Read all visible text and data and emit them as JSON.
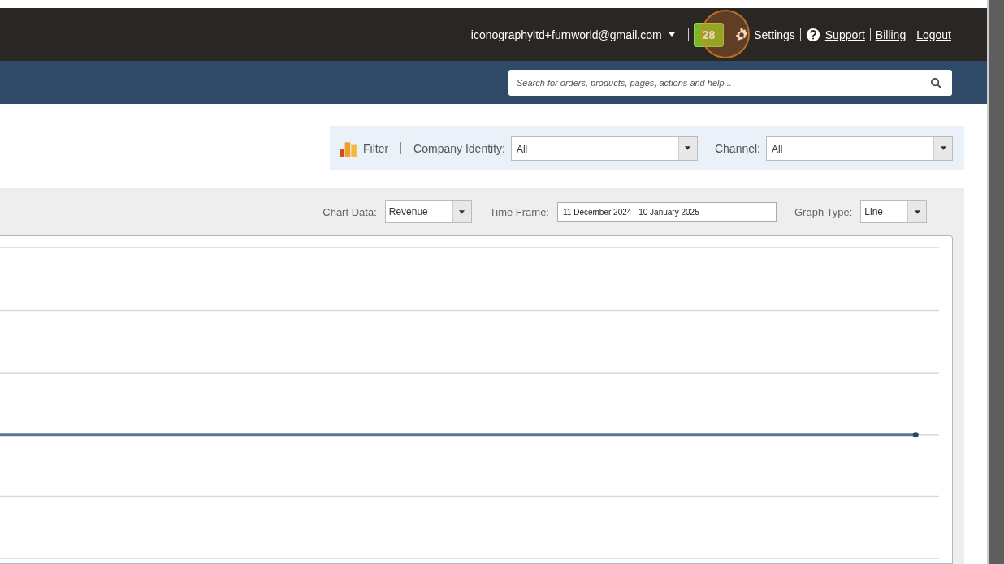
{
  "header": {
    "account": "iconographyltd+furnworld@gmail.com",
    "notification_count": "28",
    "links": [
      {
        "label": "Settings",
        "kind": "gear",
        "underlined": false
      },
      {
        "label": "Support",
        "kind": "help",
        "underlined": true
      },
      {
        "label": "Billing",
        "kind": "plain",
        "underlined": true
      },
      {
        "label": "Logout",
        "kind": "plain",
        "underlined": true
      }
    ]
  },
  "search": {
    "placeholder": "Search for orders, products, pages, actions and help..."
  },
  "filter": {
    "label": "Filter",
    "fields": [
      {
        "label": "Company Identity:",
        "value": "All"
      },
      {
        "label": "Channel:",
        "value": "All"
      }
    ]
  },
  "chart_controls": [
    {
      "label": "Chart Data:",
      "value": "Revenue",
      "kind": "select"
    },
    {
      "label": "Time Frame:",
      "value": "11 December 2024 - 10 January 2025",
      "kind": "date"
    },
    {
      "label": "Graph Type:",
      "value": "Line",
      "kind": "select"
    }
  ]
}
